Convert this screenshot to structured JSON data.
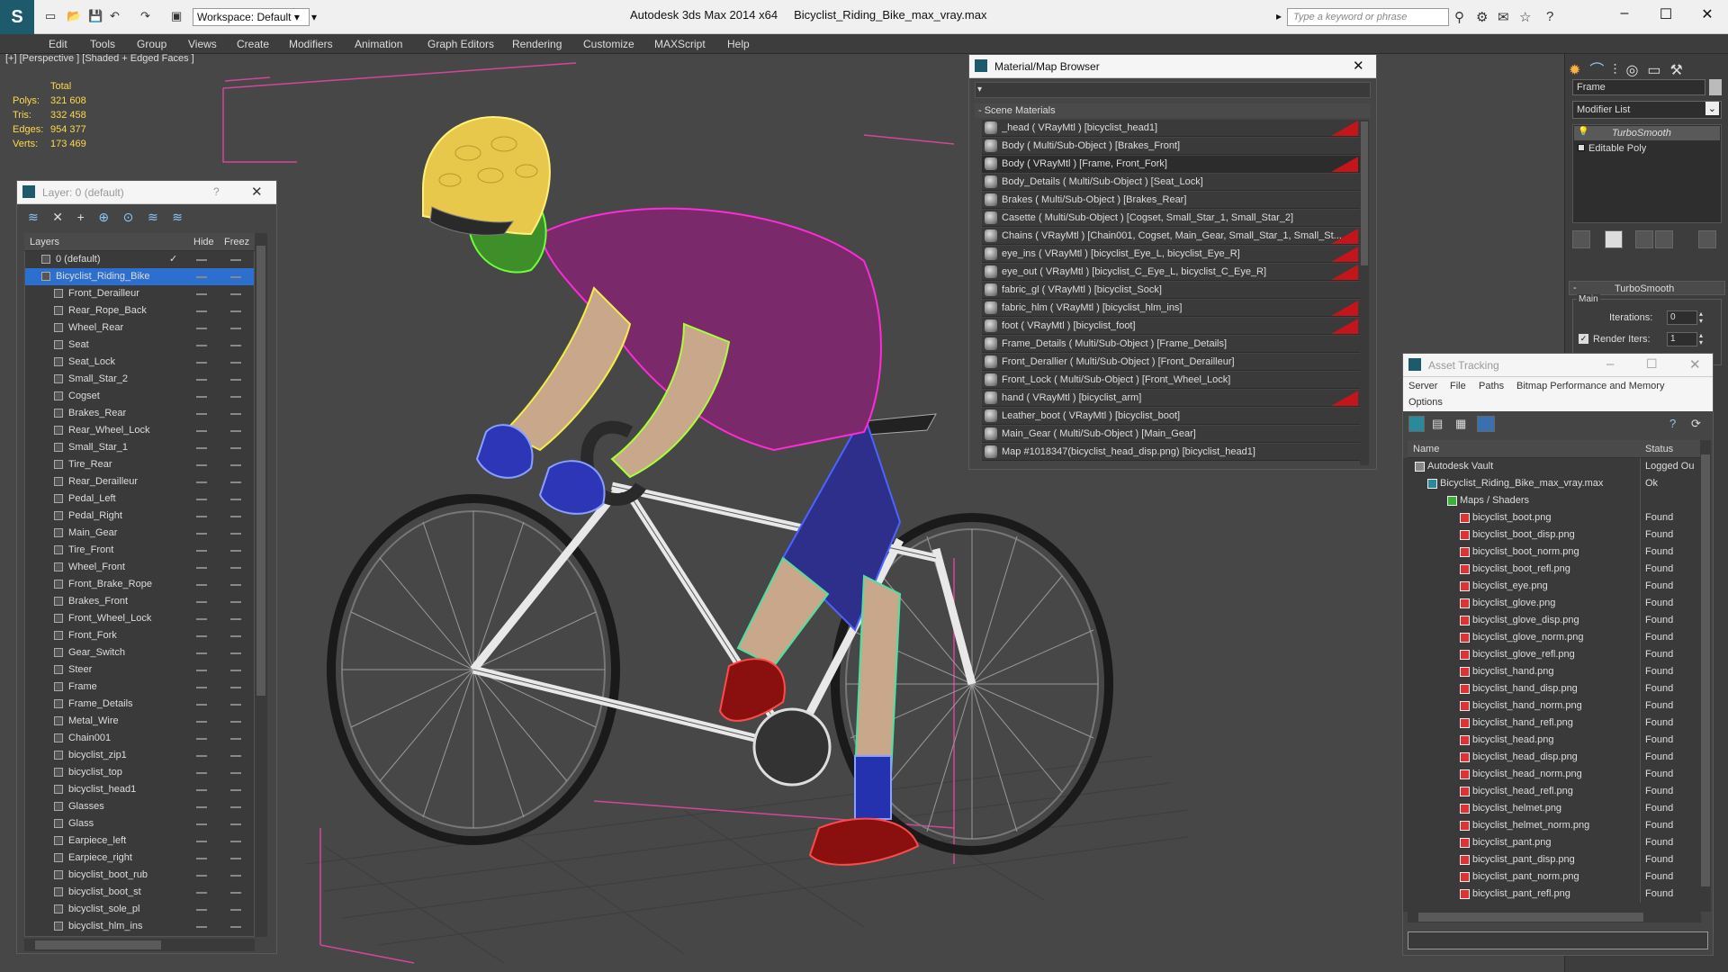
{
  "titlebar": {
    "workspace": "Workspace: Default",
    "app_title": "Autodesk 3ds Max  2014 x64",
    "file_name": "Bicyclist_Riding_Bike_max_vray.max",
    "search_placeholder": "Type a keyword or phrase"
  },
  "menu": [
    "Edit",
    "Tools",
    "Group",
    "Views",
    "Create",
    "Modifiers",
    "Animation",
    "Graph Editors",
    "Rendering",
    "Customize",
    "MAXScript",
    "Help"
  ],
  "viewport": {
    "label": "[+] [Perspective ] [Shaded + Edged Faces ]",
    "stats": {
      "total_label": "Total",
      "polys_label": "Polys:",
      "polys": "321 608",
      "tris_label": "Tris:",
      "tris": "332 458",
      "edges_label": "Edges:",
      "edges": "954 377",
      "verts_label": "Verts:",
      "verts": "173 469"
    }
  },
  "layer_panel": {
    "title": "Layer: 0 (default)",
    "help": "?",
    "col_layers": "Layers",
    "col_hide": "Hide",
    "col_freeze": "Freez",
    "layers": [
      "0 (default)",
      "Bicyclist_Riding_Bike",
      "Front_Derailleur",
      "Rear_Rope_Back",
      "Wheel_Rear",
      "Seat",
      "Seat_Lock",
      "Small_Star_2",
      "Cogset",
      "Brakes_Rear",
      "Rear_Wheel_Lock",
      "Small_Star_1",
      "Tire_Rear",
      "Rear_Derailleur",
      "Pedal_Left",
      "Pedal_Right",
      "Main_Gear",
      "Tire_Front",
      "Wheel_Front",
      "Front_Brake_Rope",
      "Brakes_Front",
      "Front_Wheel_Lock",
      "Front_Fork",
      "Gear_Switch",
      "Steer",
      "Frame",
      "Frame_Details",
      "Metal_Wire",
      "Chain001",
      "bicyclist_zip1",
      "bicyclist_top",
      "bicyclist_head1",
      "Glasses",
      "Glass",
      "Earpiece_left",
      "Earpiece_right",
      "bicyclist_boot_rub",
      "bicyclist_boot_st",
      "bicyclist_sole_pl",
      "bicyclist_hlm_ins"
    ]
  },
  "material_browser": {
    "title": "Material/Map Browser",
    "section": "- Scene Materials",
    "materials": [
      {
        "text": "_head  ( VRayMtl )  [bicyclist_head1]",
        "red": true
      },
      {
        "text": "Body  ( Multi/Sub-Object )  [Brakes_Front]",
        "red": false
      },
      {
        "text": "Body  ( VRayMtl )  [Frame, Front_Fork]",
        "red": true
      },
      {
        "text": "Body_Details  ( Multi/Sub-Object )  [Seat_Lock]",
        "red": false
      },
      {
        "text": "Brakes  ( Multi/Sub-Object )  [Brakes_Rear]",
        "red": false
      },
      {
        "text": "Casette  ( Multi/Sub-Object )  [Cogset, Small_Star_1, Small_Star_2]",
        "red": false
      },
      {
        "text": "Chains  ( VRayMtl )  [Chain001, Cogset, Main_Gear, Small_Star_1, Small_St...",
        "red": true
      },
      {
        "text": "eye_ins  ( VRayMtl )  [bicyclist_Eye_L, bicyclist_Eye_R]",
        "red": true
      },
      {
        "text": "eye_out  ( VRayMtl )  [bicyclist_C_Eye_L, bicyclist_C_Eye_R]",
        "red": true
      },
      {
        "text": "fabric_gl  ( VRayMtl )  [bicyclist_Sock]",
        "red": false
      },
      {
        "text": "fabric_hlm  ( VRayMtl )  [bicyclist_hlm_ins]",
        "red": true
      },
      {
        "text": "foot  ( VRayMtl )  [bicyclist_foot]",
        "red": true
      },
      {
        "text": "Frame_Details  ( Multi/Sub-Object )  [Frame_Details]",
        "red": false
      },
      {
        "text": "Front_Derallier  ( Multi/Sub-Object )  [Front_Derailleur]",
        "red": false
      },
      {
        "text": "Front_Lock  ( Multi/Sub-Object )  [Front_Wheel_Lock]",
        "red": false
      },
      {
        "text": "hand  ( VRayMtl )  [bicyclist_arm]",
        "red": true
      },
      {
        "text": "Leather_boot  ( VRayMtl )  [bicyclist_boot]",
        "red": false
      },
      {
        "text": "Main_Gear  ( Multi/Sub-Object )  [Main_Gear]",
        "red": false
      },
      {
        "text": "Map #1018347(bicyclist_head_disp.png)  [bicyclist_head1]",
        "red": false
      }
    ]
  },
  "asset_tracking": {
    "title": "Asset Tracking",
    "menu": [
      "Server",
      "File",
      "Paths",
      "Bitmap Performance and Memory",
      "Options"
    ],
    "col_name": "Name",
    "col_status": "Status",
    "vault": {
      "name": "Autodesk Vault",
      "status": "Logged Ou"
    },
    "file": {
      "name": "Bicyclist_Riding_Bike_max_vray.max",
      "status": "Ok"
    },
    "folder": "Maps / Shaders",
    "found": "Found",
    "maps": [
      "bicyclist_boot.png",
      "bicyclist_boot_disp.png",
      "bicyclist_boot_norm.png",
      "bicyclist_boot_refl.png",
      "bicyclist_eye.png",
      "bicyclist_glove.png",
      "bicyclist_glove_disp.png",
      "bicyclist_glove_norm.png",
      "bicyclist_glove_refl.png",
      "bicyclist_hand.png",
      "bicyclist_hand_disp.png",
      "bicyclist_hand_norm.png",
      "bicyclist_hand_refl.png",
      "bicyclist_head.png",
      "bicyclist_head_disp.png",
      "bicyclist_head_norm.png",
      "bicyclist_head_refl.png",
      "bicyclist_helmet.png",
      "bicyclist_helmet_norm.png",
      "bicyclist_pant.png",
      "bicyclist_pant_disp.png",
      "bicyclist_pant_norm.png",
      "bicyclist_pant_refl.png"
    ]
  },
  "command_panel": {
    "object_name": "Frame",
    "modifier_list": "Modifier List",
    "stack": [
      "TurboSmooth",
      "Editable Poly"
    ],
    "rollout_title": "TurboSmooth",
    "group_main": "Main",
    "iterations_label": "Iterations:",
    "iterations": "0",
    "render_iters_label": "Render Iters:",
    "render_iters": "1"
  }
}
